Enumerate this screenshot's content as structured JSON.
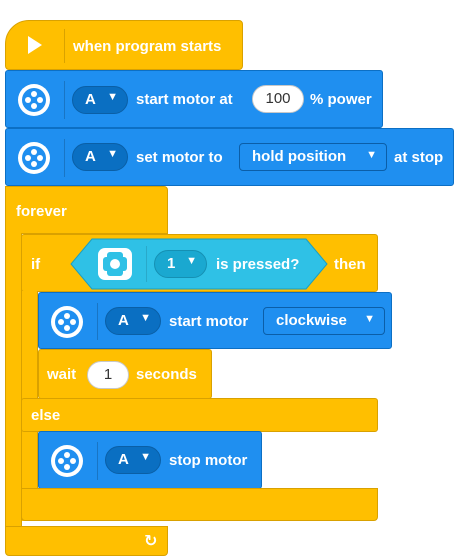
{
  "hat": {
    "label": "when program starts",
    "icon": "play-icon"
  },
  "block1": {
    "port": "A",
    "prefix": "start motor at",
    "power": "100",
    "suffix": "% power"
  },
  "block2": {
    "port": "A",
    "prefix": "set motor to",
    "mode": "hold position",
    "suffix": "at stop"
  },
  "forever": {
    "label": "forever",
    "loop_icon": "loop-arrow-icon"
  },
  "if_block": {
    "if_label": "if",
    "then_label": "then",
    "else_label": "else",
    "condition": {
      "button": "1",
      "label": "is pressed?",
      "icon": "hub-button-icon"
    }
  },
  "then_start": {
    "port": "A",
    "label": "start motor",
    "direction": "clockwise"
  },
  "wait": {
    "label": "wait",
    "value": "1",
    "unit": "seconds"
  },
  "else_stop": {
    "port": "A",
    "label": "stop motor"
  },
  "colors": {
    "yellow": "#ffbf00",
    "blue": "#1f8ff0",
    "cyan": "#2fc1e6",
    "dark_blue": "#0a6fc2"
  }
}
